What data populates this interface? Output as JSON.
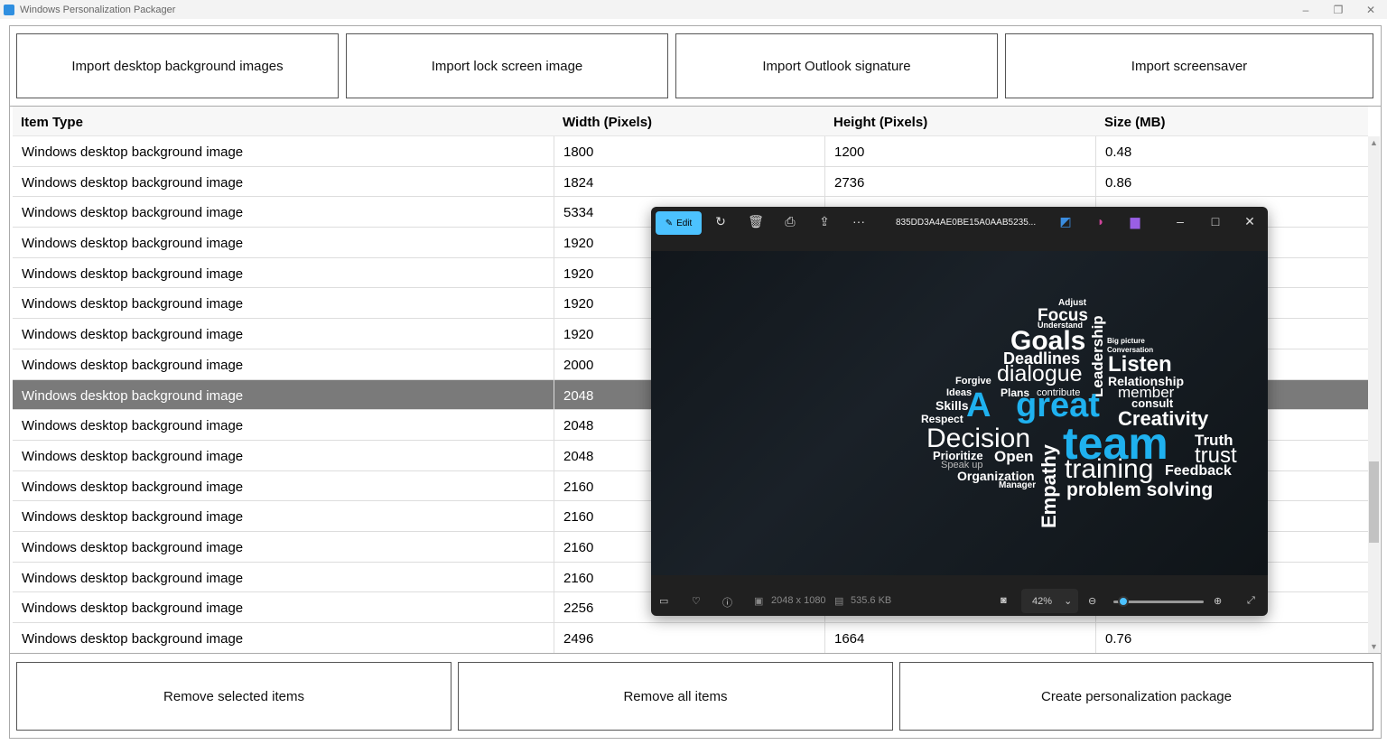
{
  "window": {
    "title": "Windows Personalization Packager",
    "minimize": "–",
    "restore": "❐",
    "close": "✕"
  },
  "top_buttons": [
    "Import desktop background images",
    "Import lock screen image",
    "Import Outlook signature",
    "Import screensaver"
  ],
  "table": {
    "headers": [
      "Item Type",
      "Width (Pixels)",
      "Height (Pixels)",
      "Size (MB)"
    ],
    "rows": [
      [
        "Windows desktop background image",
        "1800",
        "1200",
        "0.48"
      ],
      [
        "Windows desktop background image",
        "1824",
        "2736",
        "0.86"
      ],
      [
        "Windows desktop background image",
        "5334",
        "",
        ""
      ],
      [
        "Windows desktop background image",
        "1920",
        "",
        ""
      ],
      [
        "Windows desktop background image",
        "1920",
        "",
        ""
      ],
      [
        "Windows desktop background image",
        "1920",
        "",
        ""
      ],
      [
        "Windows desktop background image",
        "1920",
        "",
        ""
      ],
      [
        "Windows desktop background image",
        "2000",
        "",
        ""
      ],
      [
        "Windows desktop background image",
        "2048",
        "",
        ""
      ],
      [
        "Windows desktop background image",
        "2048",
        "",
        ""
      ],
      [
        "Windows desktop background image",
        "2048",
        "",
        ""
      ],
      [
        "Windows desktop background image",
        "2160",
        "",
        ""
      ],
      [
        "Windows desktop background image",
        "2160",
        "",
        ""
      ],
      [
        "Windows desktop background image",
        "2160",
        "",
        ""
      ],
      [
        "Windows desktop background image",
        "2160",
        "",
        ""
      ],
      [
        "Windows desktop background image",
        "2256",
        "",
        ""
      ],
      [
        "Windows desktop background image",
        "2496",
        "1664",
        "0.76"
      ]
    ],
    "selected_row": 8
  },
  "bottom_buttons": [
    "Remove selected items",
    "Remove all items",
    "Create personalization package"
  ],
  "viewer": {
    "edit_label": "Edit",
    "filename": "835DD3A4AE0BE15A0AAB5235...",
    "dimensions": "2048 x 1080",
    "filesize": "535.6 KB",
    "zoom": "42%",
    "zoom_slider_fraction": 0.05,
    "accent": "#4cc2ff",
    "words": [
      "Adjust",
      "Focus",
      "Understand",
      "Goals",
      "Leadership",
      "Big picture",
      "Conversation",
      "Deadlines",
      "Listen",
      "dialogue",
      "Forgive",
      "Relationship",
      "Ideas",
      "Plans",
      "contribute",
      "member",
      "Skills",
      "A",
      "great",
      "consult",
      "Respect",
      "Creativity",
      "Decision",
      "Empathy",
      "team",
      "Truth",
      "Prioritize",
      "Open",
      "trust",
      "Speak up",
      "training",
      "Feedback",
      "Organization",
      "Manager",
      "problem solving"
    ]
  }
}
